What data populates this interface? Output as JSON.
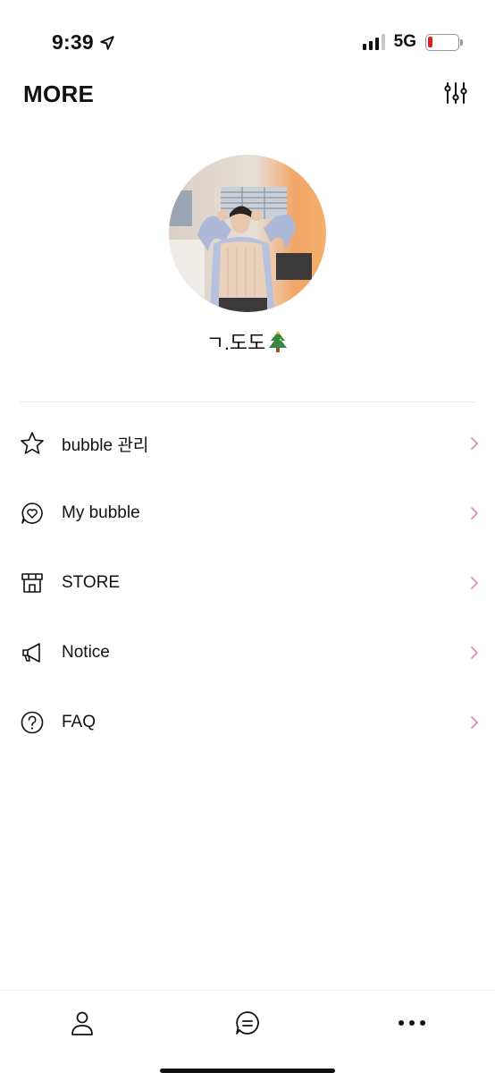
{
  "status_bar": {
    "time": "9:39",
    "network": "5G",
    "location_icon": "location-arrow-icon",
    "battery_color": "#e02020"
  },
  "header": {
    "title": "MORE",
    "settings_icon": "sliders-icon"
  },
  "profile": {
    "name": "ㄱ.도도",
    "name_emoji_icon": "christmas-tree-icon"
  },
  "menu": {
    "items": [
      {
        "label": "bubble 관리",
        "icon": "star-icon"
      },
      {
        "label": "My bubble",
        "icon": "heart-chat-icon"
      },
      {
        "label": "STORE",
        "icon": "store-icon"
      },
      {
        "label": "Notice",
        "icon": "megaphone-icon"
      },
      {
        "label": "FAQ",
        "icon": "question-circle-icon"
      }
    ],
    "chevron_color": "#e8859a"
  },
  "tabbar": {
    "tabs": [
      {
        "icon": "person-icon"
      },
      {
        "icon": "chat-bubble-icon"
      },
      {
        "icon": "more-dots-icon"
      }
    ]
  }
}
